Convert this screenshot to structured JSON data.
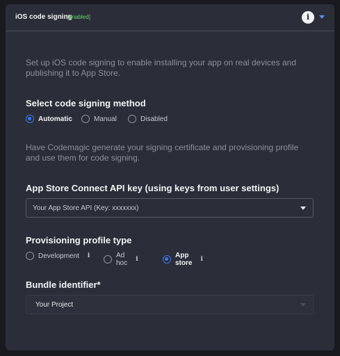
{
  "header": {
    "title": "iOS code signing",
    "badge": "[enabled]",
    "info_label": "i"
  },
  "intro": "Set up iOS code signing to enable installing your app on real devices and publishing it to App Store.",
  "signing_method": {
    "title": "Select code signing method",
    "options": [
      {
        "label": "Automatic",
        "selected": true
      },
      {
        "label": "Manual",
        "selected": false
      },
      {
        "label": "Disabled",
        "selected": false
      }
    ]
  },
  "auto_desc": "Have Codemagic generate your signing certificate and provisioning profile and use them for code signing.",
  "api_key": {
    "title": "App Store Connect API key (using keys from user settings)",
    "value": "Your App Store API (Key: xxxxxxx)"
  },
  "profile_type": {
    "title": "Provisioning profile type",
    "info_label": "i",
    "options": [
      {
        "label": "Development",
        "selected": false
      },
      {
        "label": "Ad hoc",
        "selected": false
      },
      {
        "label": "App store",
        "selected": true
      }
    ]
  },
  "bundle": {
    "title": "Bundle identifier*",
    "value": "Your Project"
  },
  "colors": {
    "accent": "#3a78f2",
    "enabled": "#6bd56e",
    "panel": "#2b2e38"
  }
}
